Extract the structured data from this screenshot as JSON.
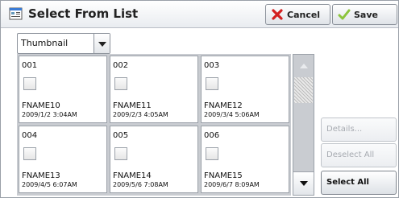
{
  "window": {
    "title": "Select From List"
  },
  "toolbar": {
    "cancel_label": "Cancel",
    "save_label": "Save"
  },
  "view": {
    "dropdown_value": "Thumbnail"
  },
  "grid": {
    "items": [
      {
        "num": "001",
        "name": "FNAME10",
        "date": "2009/1/2 3:04AM"
      },
      {
        "num": "002",
        "name": "FNAME11",
        "date": "2009/2/3 4:05AM"
      },
      {
        "num": "003",
        "name": "FNAME12",
        "date": "2009/3/4 5:06AM"
      },
      {
        "num": "004",
        "name": "FNAME13",
        "date": "2009/4/5 6:07AM"
      },
      {
        "num": "005",
        "name": "FNAME14",
        "date": "2009/5/6 7:08AM"
      },
      {
        "num": "006",
        "name": "FNAME15",
        "date": "2009/6/7 8:09AM"
      }
    ]
  },
  "side_buttons": {
    "details": "Details...",
    "deselect_all": "Deselect All",
    "select_all": "Select All"
  },
  "colors": {
    "cancel_x": "#d32020",
    "save_check": "#8cc43c"
  }
}
